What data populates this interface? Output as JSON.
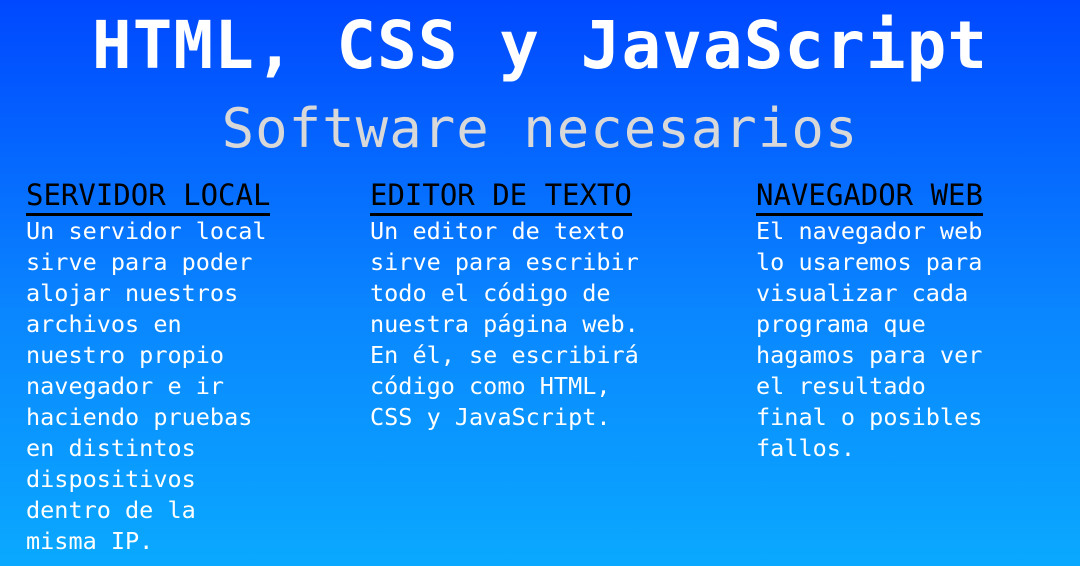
{
  "header": {
    "title": "HTML, CSS y JavaScript",
    "subtitle": "Software necesarios"
  },
  "columns": [
    {
      "heading": "SERVIDOR LOCAL",
      "text": "Un servidor local\nsirve para poder\nalojar nuestros\narchivos en\nnuestro propio\nnavegador e ir\nhaciendo pruebas\nen distintos\ndispositivos\ndentro de la\nmisma IP."
    },
    {
      "heading": "EDITOR DE TEXTO",
      "text": "Un editor de texto\nsirve para escribir\ntodo el código de\nnuestra página web.\nEn él, se escribirá\ncódigo como HTML,\nCSS y JavaScript."
    },
    {
      "heading": "NAVEGADOR WEB",
      "text": "El navegador web\nlo usaremos para\nvisualizar cada\nprograma que\nhagamos para ver\nel resultado\nfinal o posibles\nfallos."
    }
  ],
  "colors": {
    "gradient_top": "#0048ff",
    "gradient_bottom": "#0aa9ff",
    "title": "#ffffff",
    "subtitle": "#d8d8d8",
    "heading": "#000000",
    "body_text": "#ffffff"
  }
}
